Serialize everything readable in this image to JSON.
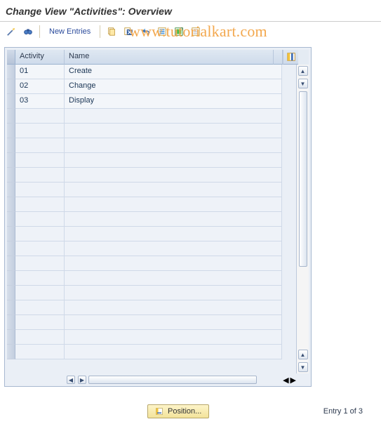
{
  "title": "Change View \"Activities\": Overview",
  "toolbar": {
    "new_entries_label": "New Entries",
    "icons": {
      "menu": "menu-icon",
      "table_settings": "table-settings-icon",
      "copy": "copy-icon",
      "delete": "delete-icon",
      "undo": "undo-icon",
      "select_all": "select-all-icon",
      "save": "save-variant-icon",
      "deselect_all": "deselect-all-icon"
    }
  },
  "watermark_text": "www.tutorialkart.com",
  "table": {
    "columns": {
      "activity": "Activity",
      "name": "Name"
    },
    "config_icon": "table-config-icon",
    "rows": [
      {
        "activity": "01",
        "name": "Create"
      },
      {
        "activity": "02",
        "name": "Change"
      },
      {
        "activity": "03",
        "name": "Display"
      }
    ],
    "empty_row_count": 17
  },
  "footer": {
    "position_label": "Position...",
    "entry_status": "Entry 1 of 3"
  }
}
